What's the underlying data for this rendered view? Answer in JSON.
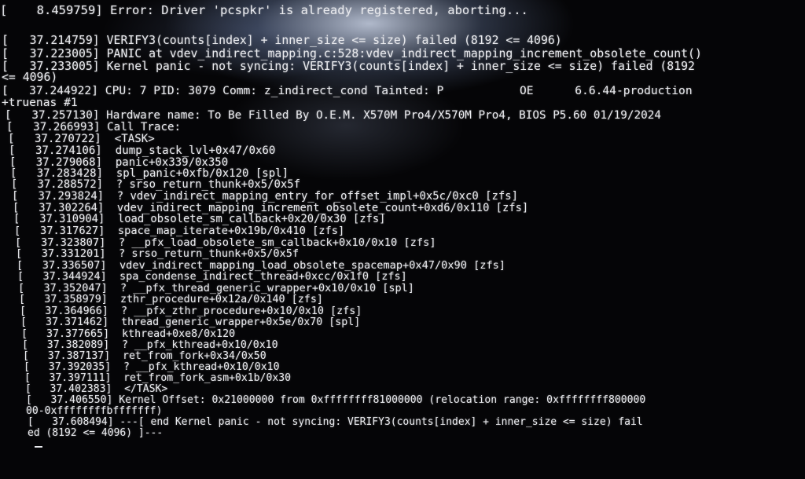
{
  "console": {
    "lines": [
      "[    8.459759] Error: Driver 'pcspkr' is already registered, aborting...",
      "[   37.214759] VERIFY3(counts[index] + inner_size <= size) failed (8192 <= 4096)",
      "[   37.223005] PANIC at vdev_indirect_mapping.c:528:vdev_indirect_mapping_increment_obsolete_count()",
      "[   37.233005] Kernel panic - not syncing: VERIFY3(counts[index] + inner_size <= size) failed (8192",
      "<= 4096)",
      "[   37.244922] CPU: 7 PID: 3079 Comm: z_indirect_cond Tainted: P           OE      6.6.44-production",
      "+truenas #1",
      "[   37.257130] Hardware name: To Be Filled By O.E.M. X570M Pro4/X570M Pro4, BIOS P5.60 01/19/2024",
      "[   37.266993] Call Trace:",
      "[   37.270722]  <TASK>",
      "[   37.274106]  dump_stack_lvl+0x47/0x60",
      "[   37.279068]  panic+0x339/0x350",
      "[   37.283428]  spl_panic+0xfb/0x120 [spl]",
      "[   37.288572]  ? srso_return_thunk+0x5/0x5f",
      "[   37.293824]  ? vdev_indirect_mapping_entry_for_offset_impl+0x5c/0xc0 [zfs]",
      "[   37.302264]  vdev_indirect_mapping_increment_obsolete_count+0xd6/0x110 [zfs]",
      "[   37.310904]  load_obsolete_sm_callback+0x20/0x30 [zfs]",
      "[   37.317627]  space_map_iterate+0x19b/0x410 [zfs]",
      "[   37.323807]  ? __pfx_load_obsolete_sm_callback+0x10/0x10 [zfs]",
      "[   37.331201]  ? srso_return_thunk+0x5/0x5f",
      "[   37.336507]  vdev_indirect_mapping_load_obsolete_spacemap+0x47/0x90 [zfs]",
      "[   37.344924]  spa_condense_indirect_thread+0xcc/0x1f0 [zfs]",
      "[   37.352047]  ? __pfx_thread_generic_wrapper+0x10/0x10 [spl]",
      "[   37.358979]  zthr_procedure+0x12a/0x140 [zfs]",
      "[   37.364966]  ? __pfx_zthr_procedure+0x10/0x10 [zfs]",
      "[   37.371462]  thread_generic_wrapper+0x5e/0x70 [spl]",
      "[   37.377665]  kthread+0xe8/0x120",
      "[   37.382089]  ? __pfx_kthread+0x10/0x10",
      "[   37.387137]  ret_from_fork+0x34/0x50",
      "[   37.392035]  ? __pfx_kthread+0x10/0x10",
      "[   37.397111]  ret_from_fork_asm+0x1b/0x30",
      "[   37.402383]  </TASK>",
      "[   37.406550] Kernel Offset: 0x21000000 from 0xffffffff81000000 (relocation range: 0xffffffff800000",
      "00-0xffffffffbfffffff)",
      "[   37.608494] ---[ end Kernel panic - not syncing: VERIFY3(counts[index] + inner_size <= size) fail",
      "ed (8192 <= 4096) ]---"
    ],
    "cursor": "_"
  }
}
